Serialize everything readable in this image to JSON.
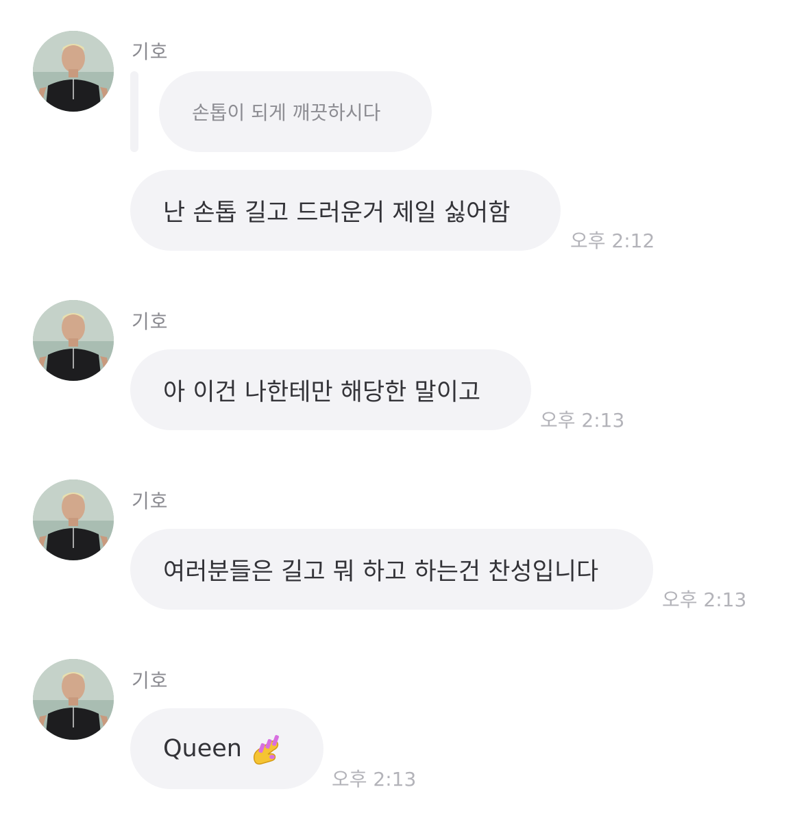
{
  "messages": [
    {
      "sender": "기호",
      "reply_quote": "손톱이 되게 깨끗하시다",
      "text": "난 손톱 길고 드러운거 제일 싫어함",
      "time": "오후 2:12"
    },
    {
      "sender": "기호",
      "text": "아 이건 나한테만 해당한 말이고",
      "time": "오후 2:13"
    },
    {
      "sender": "기호",
      "text": "여러분들은 길고 뭐 하고 하는건 찬성입니다",
      "time": "오후 2:13"
    },
    {
      "sender": "기호",
      "text": "Queen",
      "emoji": "nail-polish-icon",
      "time": "오후 2:13"
    }
  ],
  "colors": {
    "bubble": "#f3f3f6",
    "text": "#333338",
    "name": "#8a8a90",
    "time": "#b3b3b9",
    "emoji_nail": "#d86fe0",
    "emoji_hand": "#f5c433"
  }
}
